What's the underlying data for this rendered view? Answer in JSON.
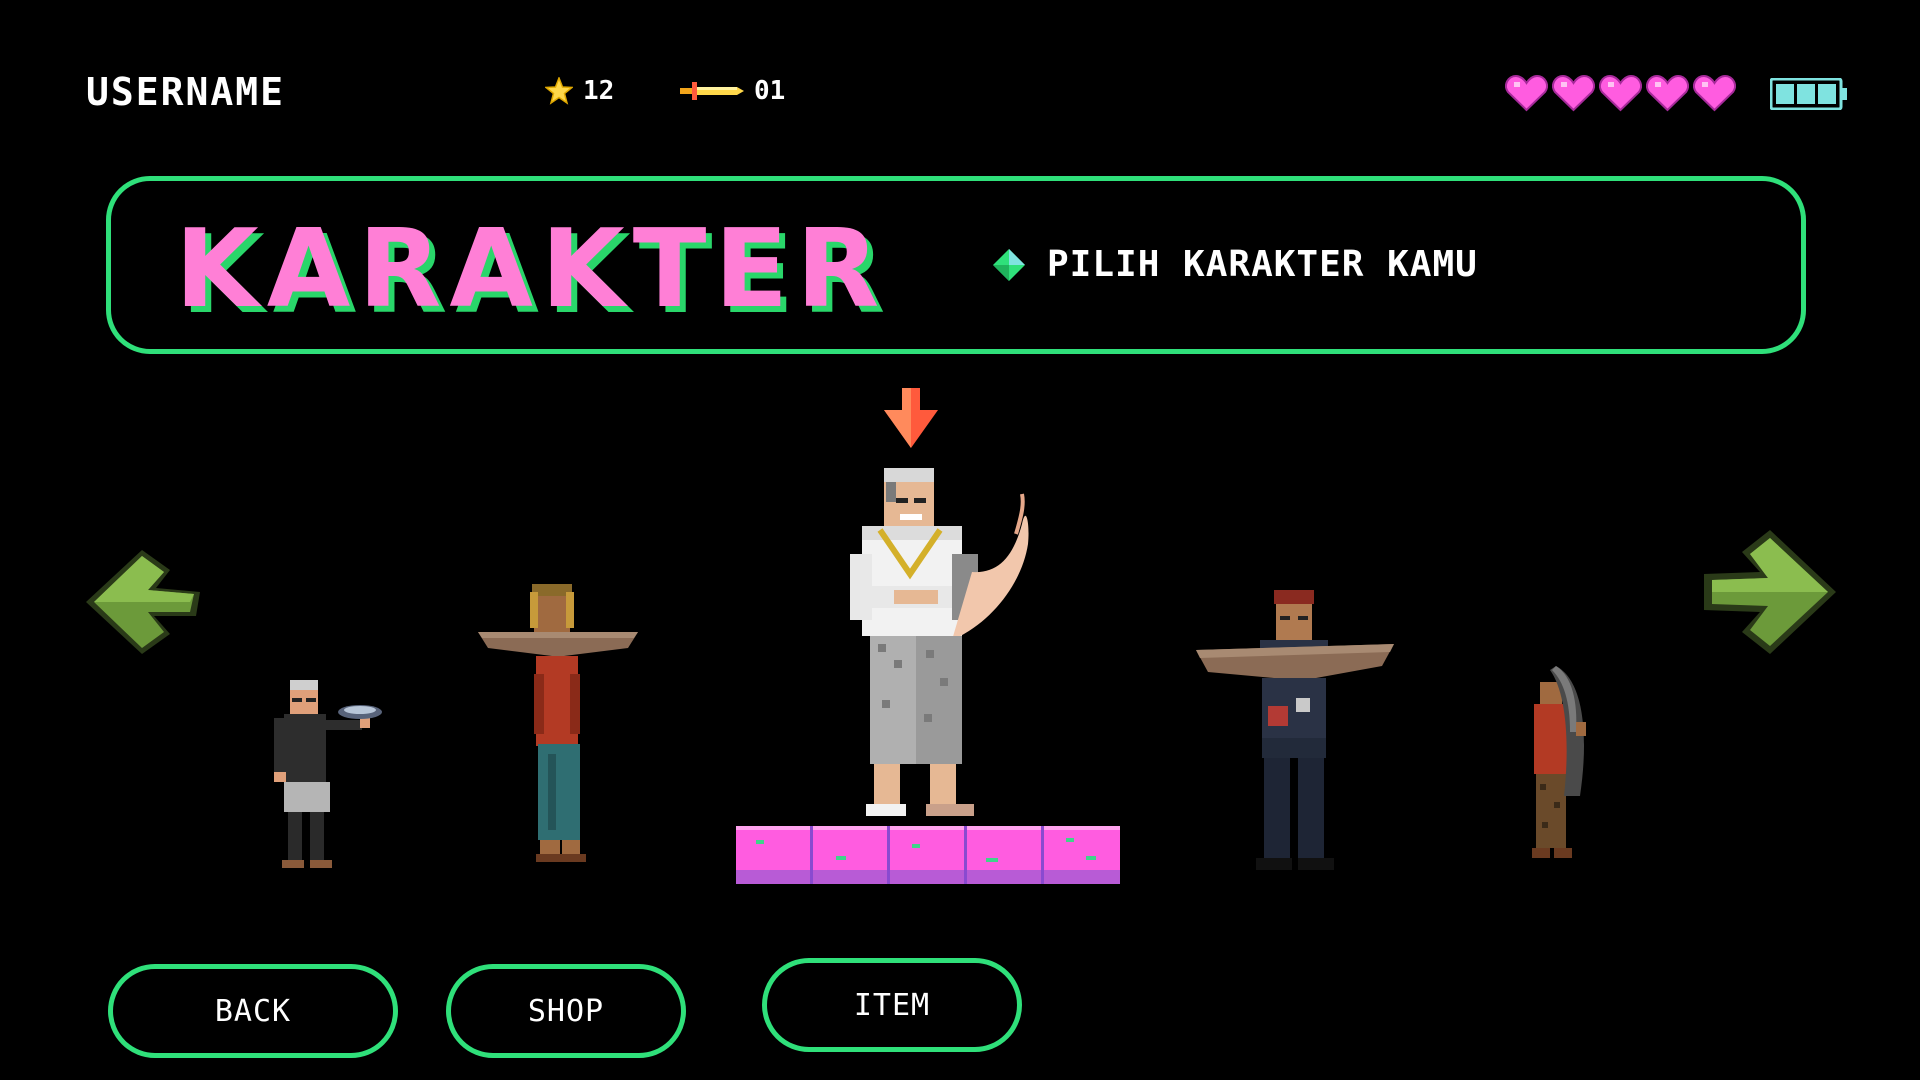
{
  "hud": {
    "username": "USERNAME",
    "stars": "12",
    "swords": "01",
    "hearts": 5,
    "heart_color": "#ff5ce0",
    "battery_color": "#7fe3e0",
    "icons": {
      "stars": "star-icon",
      "swords": "sword-icon",
      "hearts": "heart-icon",
      "battery": "battery-icon"
    }
  },
  "header": {
    "title": "KARAKTER",
    "subtitle": "PILIH KARAKTER KAMU",
    "title_color": "#ff7fd6",
    "accent_color": "#2fe07a"
  },
  "characters": [
    {
      "id": "character-1",
      "selected": false
    },
    {
      "id": "character-2",
      "selected": false
    },
    {
      "id": "character-3",
      "selected": true
    },
    {
      "id": "character-4",
      "selected": false
    },
    {
      "id": "character-5",
      "selected": false
    }
  ],
  "navigation": {
    "prev_icon": "arrow-left-icon",
    "next_icon": "arrow-right-icon",
    "arrow_color": "#6c9a3a"
  },
  "buttons": {
    "back": "BACK",
    "shop": "SHOP",
    "item": "ITEM"
  }
}
